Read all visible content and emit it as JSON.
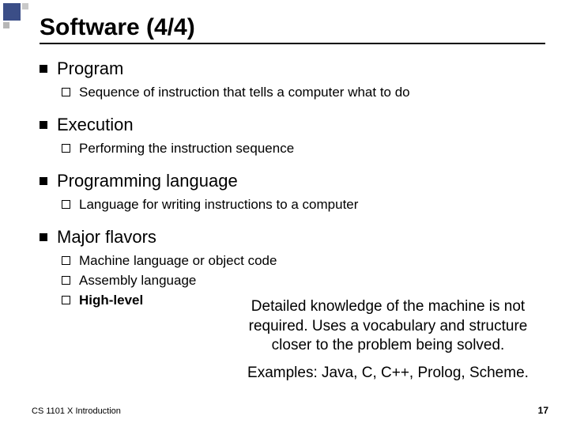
{
  "title": "Software (4/4)",
  "items": [
    {
      "label": "Program",
      "sub": [
        {
          "text": "Sequence of instruction that tells a computer what to do"
        }
      ]
    },
    {
      "label": "Execution",
      "sub": [
        {
          "text": "Performing the instruction sequence"
        }
      ]
    },
    {
      "label": "Programming language",
      "sub": [
        {
          "text": "Language for writing instructions to a computer"
        }
      ]
    },
    {
      "label": "Major flavors",
      "sub": [
        {
          "text": "Machine language or object code"
        },
        {
          "text": "Assembly language"
        },
        {
          "text": "High-level",
          "bold": true
        }
      ]
    }
  ],
  "callout": {
    "body": "Detailed knowledge of the machine is not required. Uses a vocabulary and structure closer to the problem being solved.",
    "examples": "Examples: Java, C, C++, Prolog, Scheme."
  },
  "footer": {
    "left": "CS 1101 X Introduction",
    "right": "17"
  }
}
